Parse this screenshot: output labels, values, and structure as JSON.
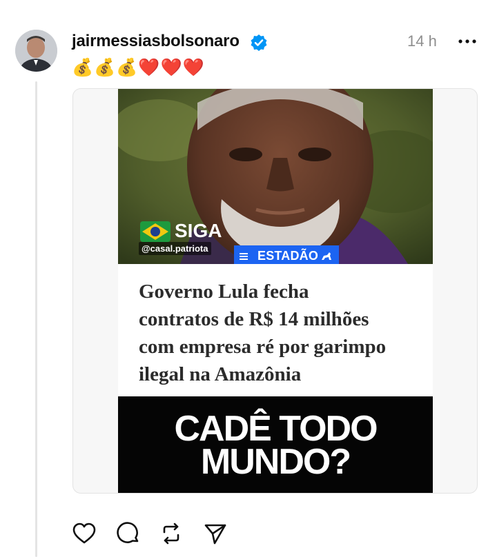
{
  "post": {
    "username": "jairmessiasbolsonaro",
    "verified": true,
    "timestamp": "14 h",
    "caption": "💰💰💰❤️❤️❤️",
    "avatar_icon": "profile-photo"
  },
  "media": {
    "watermark": {
      "title": "SIGA",
      "handle": "@casal.patriota"
    },
    "source_label": "ESTADÃO",
    "headline": "Governo Lula fecha\ncontratos de R$ 14 milhões\ncom empresa ré por garimpo\nilegal na Amazônia",
    "overlay_text": "CADÊ TODO\nMUNDO?"
  },
  "actions": {
    "like_icon": "heart-icon",
    "reply_icon": "comment-icon",
    "repost_icon": "repost-icon",
    "share_icon": "send-icon"
  },
  "colors": {
    "verified_blue": "#0095f6",
    "estadao_blue": "#1c64f2",
    "muted_text": "#8e8e8e"
  }
}
